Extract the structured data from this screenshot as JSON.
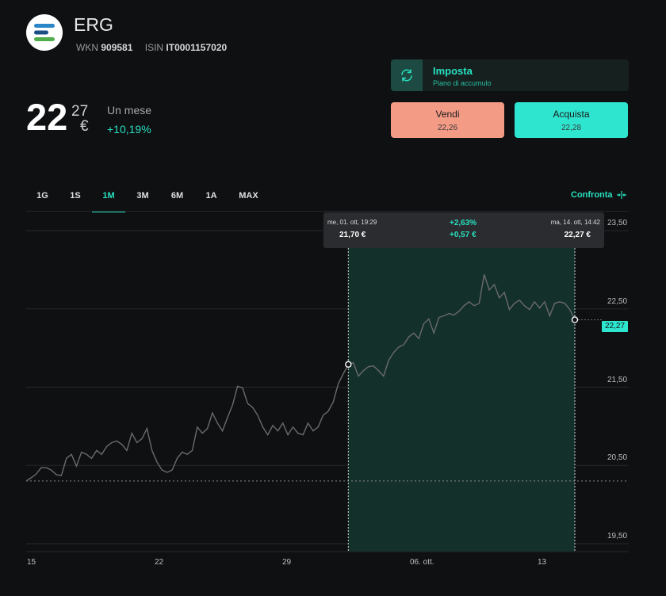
{
  "header": {
    "name": "ERG",
    "wkn_label": "WKN",
    "wkn": "909581",
    "isin_label": "ISIN",
    "isin": "IT0001157020",
    "logo_icon": "erg-logo"
  },
  "price": {
    "integer": "22",
    "decimals": "27",
    "currency": "€",
    "period_label": "Un mese",
    "period_change": "+10,19%"
  },
  "savings_plan": {
    "icon": "refresh-icon",
    "title": "Imposta",
    "subtitle": "Piano di accumulo"
  },
  "trade": {
    "sell_label": "Vendi",
    "sell_price": "22,26",
    "buy_label": "Acquista",
    "buy_price": "22,28"
  },
  "tabs": [
    "1G",
    "1S",
    "1M",
    "3M",
    "6M",
    "1A",
    "MAX"
  ],
  "active_tab": "1M",
  "compare_label": "Confronta",
  "tooltip": {
    "start_date": "me, 01. ott, 19:29",
    "start_value": "21,70 €",
    "change_pct": "+2,63%",
    "change_abs": "+0,57 €",
    "end_date": "ma, 14. ott, 14:42",
    "end_value": "22,27 €"
  },
  "last_value_badge": "22,27",
  "colors": {
    "accent": "#28e0c0",
    "sell": "#f49b86",
    "buy": "#2ee6d0",
    "background": "#0f1012",
    "line": "#6b6b6b",
    "highlight_fill": "#13302b"
  },
  "chart_data": {
    "type": "line",
    "y_ticks": [
      "23,50",
      "22,50",
      "21,50",
      "20,50",
      "19,50"
    ],
    "x_ticks": [
      "15",
      "22",
      "29",
      "06. ott.",
      "13"
    ],
    "ylim": [
      19.5,
      23.5
    ],
    "reference_value": 20.21,
    "selection": {
      "start": 21.7,
      "end": 22.27
    },
    "series": [
      {
        "values": [
          20.21,
          20.25,
          20.3,
          20.38,
          20.38,
          20.35,
          20.29,
          20.28,
          20.5,
          20.55,
          20.4,
          20.58,
          20.55,
          20.5,
          20.6,
          20.55,
          20.65,
          20.7,
          20.72,
          20.68,
          20.6,
          20.82,
          20.7,
          20.75,
          20.88,
          20.6,
          20.45,
          20.35,
          20.32,
          20.35,
          20.5,
          20.58,
          20.55,
          20.6,
          20.9,
          20.82,
          20.88,
          21.08,
          20.95,
          20.85,
          21.02,
          21.18,
          21.42,
          21.4,
          21.2,
          21.15,
          21.05,
          20.9,
          20.8,
          20.92,
          20.85,
          20.95,
          20.8,
          20.9,
          20.82,
          20.8,
          20.95,
          20.85,
          20.9,
          21.05,
          21.1,
          21.22,
          21.45,
          21.58,
          21.7,
          21.72,
          21.55,
          21.62,
          21.67,
          21.68,
          21.62,
          21.55,
          21.75,
          21.85,
          21.92,
          21.95,
          22.05,
          22.1,
          22.03,
          22.22,
          22.28,
          22.1,
          22.3,
          22.32,
          22.35,
          22.33,
          22.38,
          22.45,
          22.5,
          22.45,
          22.48,
          22.85,
          22.65,
          22.72,
          22.55,
          22.62,
          22.4,
          22.48,
          22.52,
          22.45,
          22.4,
          22.5,
          22.42,
          22.5,
          22.32,
          22.48,
          22.5,
          22.48,
          22.4,
          22.27
        ]
      }
    ]
  }
}
